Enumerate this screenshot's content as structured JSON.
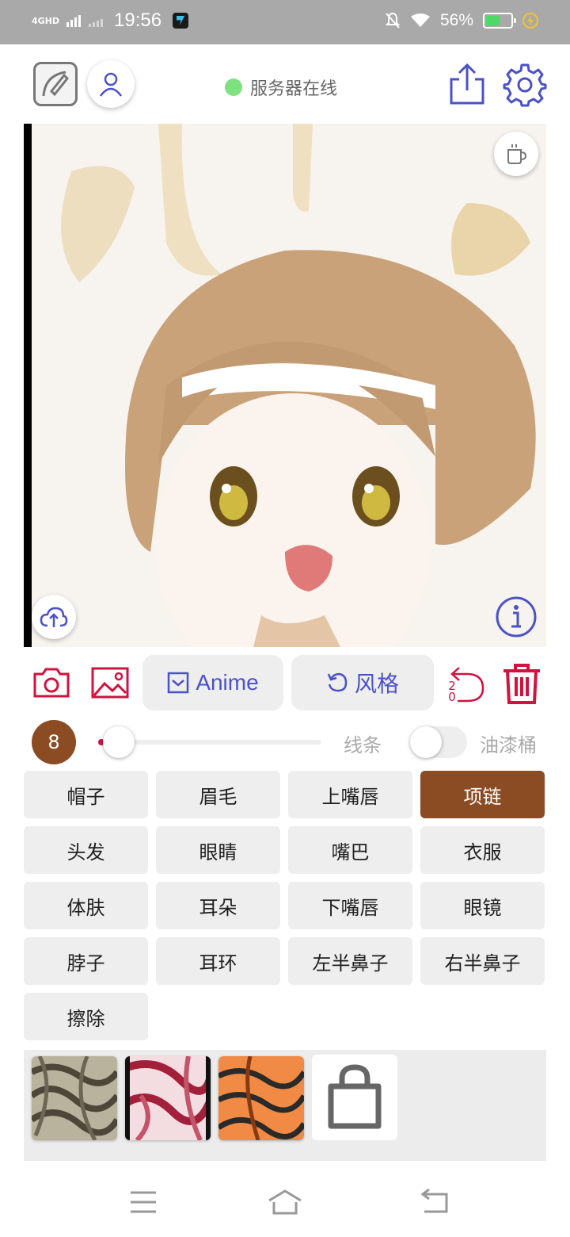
{
  "status_bar": {
    "network": "4GHD",
    "time": "19:56",
    "battery_percent": "56%",
    "battery_level": 0.56,
    "icons": [
      "signal-icon",
      "app-notification-icon",
      "mute-icon",
      "wifi-icon",
      "battery-icon",
      "charging-icon"
    ]
  },
  "header": {
    "server_status": "服务器在线",
    "server_status_color": "#7ee07e",
    "icons": [
      "sketch-icon",
      "user-icon",
      "share-icon",
      "gear-icon"
    ]
  },
  "canvas": {
    "icons": [
      "coffee-icon",
      "upload-icon",
      "info-icon"
    ]
  },
  "toolbar": {
    "anime_label": "Anime",
    "style_label": "风格",
    "undo_count": "2\n0",
    "accent_color": "#d3123d",
    "pill_text_color": "#4a52c7",
    "icons": [
      "camera-icon",
      "image-icon",
      "checkbox-icon",
      "refresh-icon",
      "undo-icon",
      "trash-icon"
    ]
  },
  "brush": {
    "size": "8",
    "size_color": "#8b4c24",
    "slider_value": 0.0,
    "line_label": "线条",
    "bucket_label": "油漆桶",
    "bucket_enabled": false
  },
  "parts": [
    {
      "label": "帽子",
      "active": false
    },
    {
      "label": "眉毛",
      "active": false
    },
    {
      "label": "上嘴唇",
      "active": false
    },
    {
      "label": "项链",
      "active": true
    },
    {
      "label": "头发",
      "active": false
    },
    {
      "label": "眼睛",
      "active": false
    },
    {
      "label": "嘴巴",
      "active": false
    },
    {
      "label": "衣服",
      "active": false
    },
    {
      "label": "体肤",
      "active": false
    },
    {
      "label": "耳朵",
      "active": false
    },
    {
      "label": "下嘴唇",
      "active": false
    },
    {
      "label": "眼镜",
      "active": false
    },
    {
      "label": "脖子",
      "active": false
    },
    {
      "label": "耳环",
      "active": false
    },
    {
      "label": "左半鼻子",
      "active": false
    },
    {
      "label": "右半鼻子",
      "active": false
    },
    {
      "label": "擦除",
      "active": false
    }
  ],
  "textures": [
    {
      "name": "texture-gray",
      "colors": [
        "#b3ad98",
        "#5a5446"
      ]
    },
    {
      "name": "texture-pink",
      "colors": [
        "#f1d7dc",
        "#a0243d"
      ]
    },
    {
      "name": "texture-orange",
      "colors": [
        "#f08a44",
        "#2a2a2a"
      ]
    }
  ],
  "nav": {
    "icons": [
      "menu-icon",
      "home-icon",
      "back-icon"
    ]
  }
}
